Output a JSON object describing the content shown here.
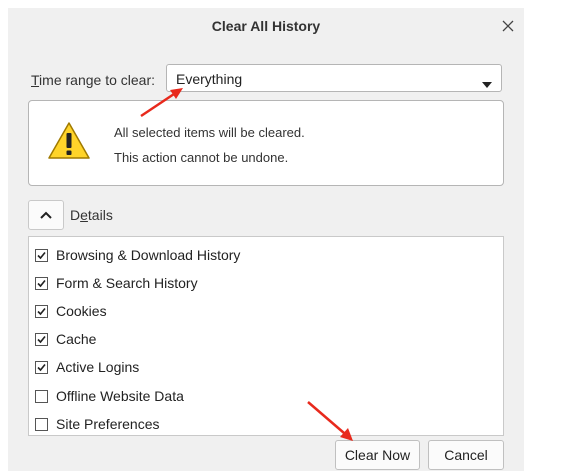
{
  "dialog": {
    "title": "Clear All History",
    "close_icon": "close-icon"
  },
  "time_range": {
    "label_prefix": "T",
    "label_rest": "ime range to clear:",
    "selected": "Everything",
    "dropdown_icon": "triangle-down-icon"
  },
  "warning": {
    "icon": "warning-triangle-icon",
    "line1": "All selected items will be cleared.",
    "line2": "This action cannot be undone."
  },
  "details": {
    "toggle_icon": "chevron-up-icon",
    "label_prefix": "D",
    "label_underlined": "e",
    "label_rest": "tails"
  },
  "items": [
    {
      "label": "Browsing & Download History",
      "checked": true
    },
    {
      "label": "Form & Search History",
      "checked": true
    },
    {
      "label": "Cookies",
      "checked": true
    },
    {
      "label": "Cache",
      "checked": true
    },
    {
      "label": "Active Logins",
      "checked": true
    },
    {
      "label": "Offline Website Data",
      "checked": false
    },
    {
      "label": "Site Preferences",
      "checked": false
    }
  ],
  "buttons": {
    "clear_now": "Clear Now",
    "cancel": "Cancel"
  },
  "colors": {
    "annotation_arrow": "#e8291c",
    "warning_fill": "#ffd42a"
  }
}
